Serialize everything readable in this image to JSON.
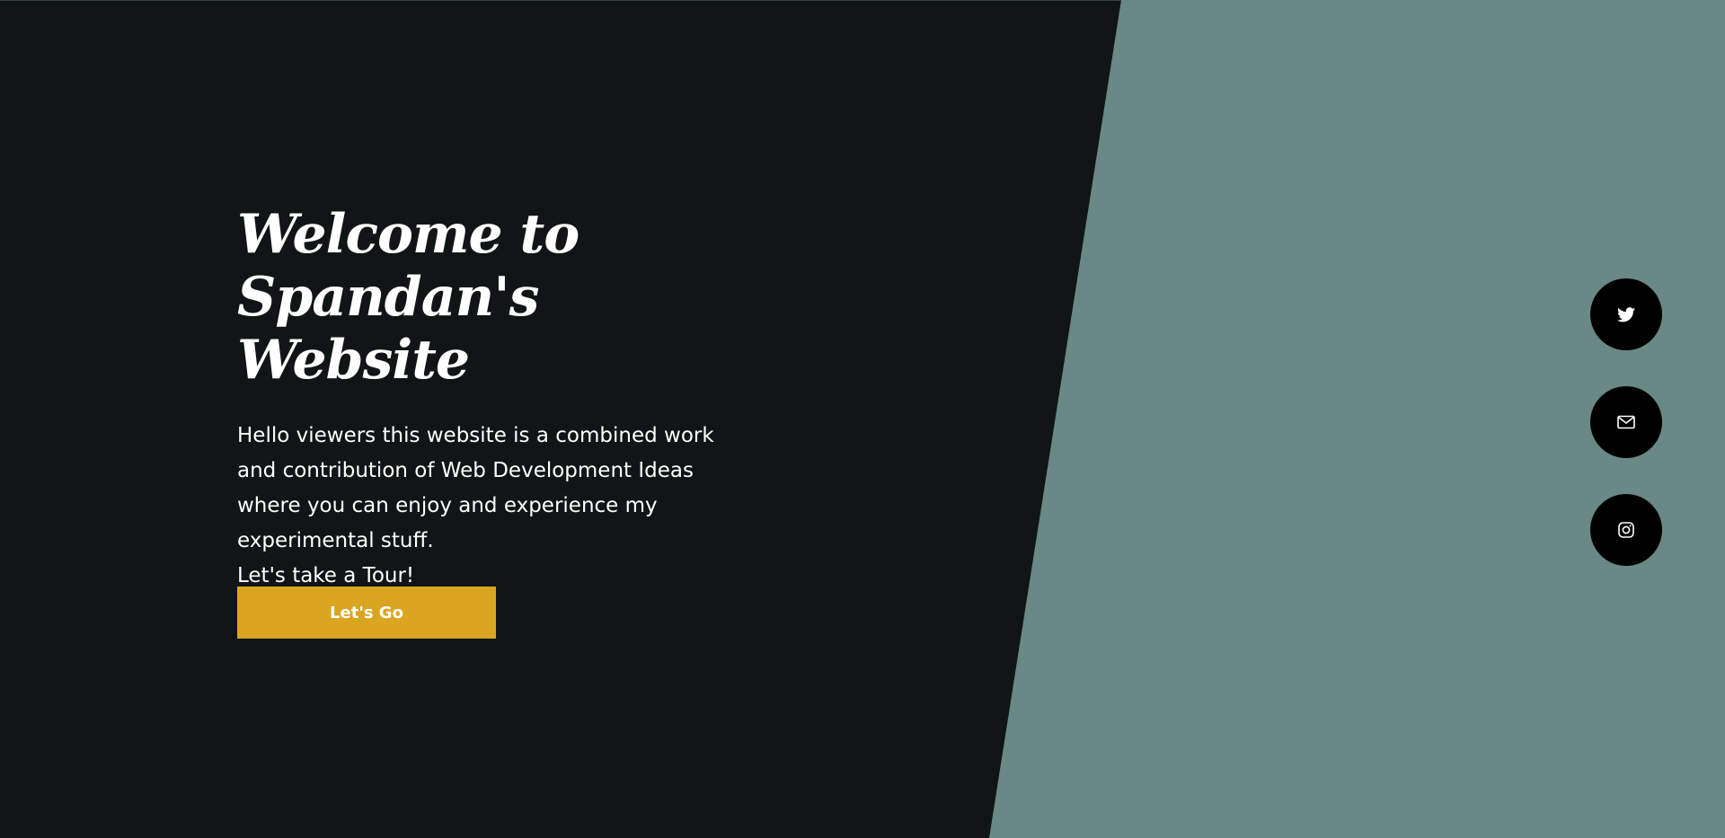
{
  "hero": {
    "title_line1": "Welcome to",
    "title_line2": "Spandan's Website",
    "paragraph": "Hello viewers this website is a combined work and contribution of Web Development Ideas where you can enjoy and experience my experimental stuff.",
    "tagline": "Let's take a Tour!"
  },
  "cta": {
    "label": "Let's Go"
  },
  "social_links": [
    {
      "icon": "twitter-icon"
    },
    {
      "icon": "mail-icon"
    },
    {
      "icon": "instagram-icon"
    }
  ],
  "colors": {
    "background_dark": "#111516",
    "panel_teal": "#698886",
    "accent_gold": "#daa520",
    "social_bg": "#000000",
    "text": "#ffffff"
  }
}
